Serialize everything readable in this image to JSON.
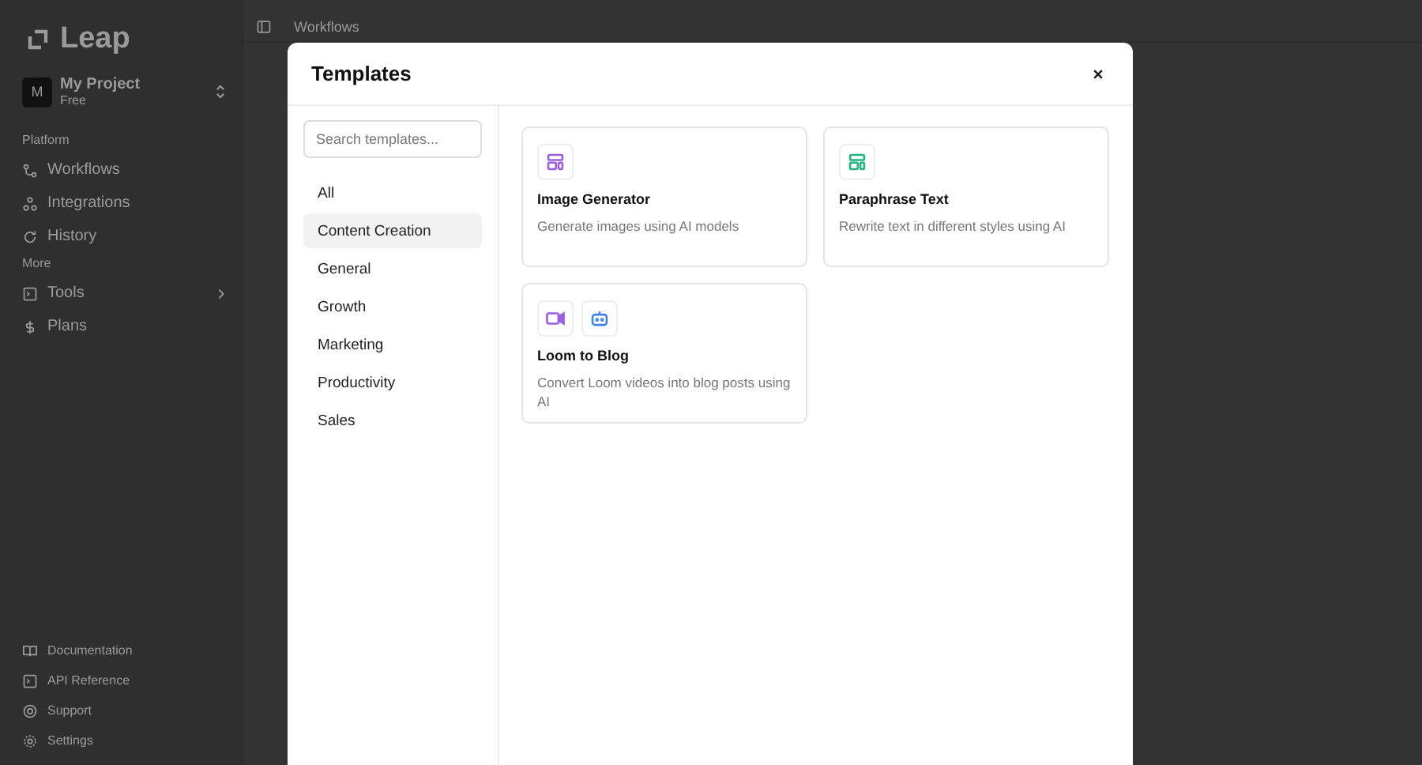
{
  "app": {
    "logo": "Leap",
    "project": {
      "initial": "M",
      "name": "My Project",
      "plan": "Free"
    },
    "sections": [
      {
        "title": "Platform",
        "items": [
          {
            "label": "Workflows",
            "kind": "workflow"
          },
          {
            "label": "Integrations",
            "kind": "integrations"
          },
          {
            "label": "History",
            "kind": "history"
          }
        ]
      },
      {
        "title": "More",
        "items": [
          {
            "label": "Tools",
            "kind": "terminal",
            "submenu": true
          },
          {
            "label": "Plans",
            "kind": "dollar",
            "submenu": false
          }
        ]
      }
    ],
    "footer_items": [
      {
        "label": "Documentation",
        "kind": "book"
      },
      {
        "label": "API Reference",
        "kind": "terminal"
      },
      {
        "label": "Support",
        "kind": "support"
      },
      {
        "label": "Settings",
        "kind": "gear"
      }
    ],
    "breadcrumb": "Workflows"
  },
  "modal": {
    "title": "Templates",
    "search": {
      "placeholder": "Search templates..."
    },
    "categories": [
      {
        "label": "All",
        "selected": false
      },
      {
        "label": "Content Creation",
        "selected": true
      },
      {
        "label": "General",
        "selected": false
      },
      {
        "label": "Growth",
        "selected": false
      },
      {
        "label": "Marketing",
        "selected": false
      },
      {
        "label": "Productivity",
        "selected": false
      },
      {
        "label": "Sales",
        "selected": false
      }
    ],
    "templates": [
      {
        "title": "Image Generator",
        "description": "Generate images using AI models",
        "icons": [
          {
            "kind": "layout",
            "color": "#9b5de5"
          }
        ]
      },
      {
        "title": "Paraphrase Text",
        "description": "Rewrite text in different styles using AI",
        "icons": [
          {
            "kind": "layout",
            "color": "#1fb37f"
          }
        ]
      },
      {
        "title": "Loom to Blog",
        "description": "Convert Loom videos into blog posts using AI",
        "icons": [
          {
            "kind": "video",
            "color": "#9b5de5"
          },
          {
            "kind": "robot",
            "color": "#3b82f6"
          }
        ]
      }
    ]
  }
}
